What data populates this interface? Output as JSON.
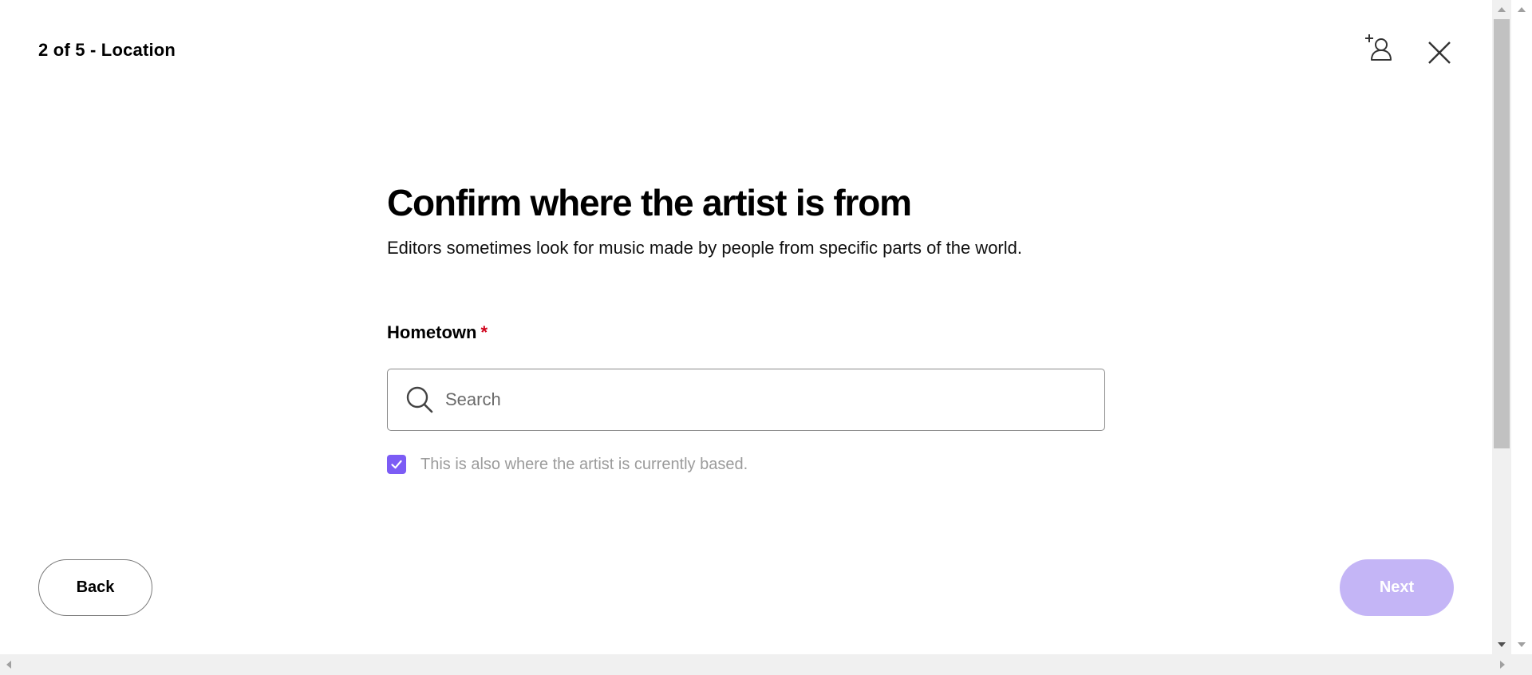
{
  "header": {
    "step_label": "2 of 5 - Location",
    "add_user_icon": "add-user-icon",
    "close_icon": "close-icon"
  },
  "main": {
    "title": "Confirm where the artist is from",
    "subtitle": "Editors sometimes look for music made by people from specific parts of the world.",
    "hometown": {
      "label": "Hometown",
      "required_marker": "*",
      "placeholder": "Search",
      "value": ""
    },
    "currently_based": {
      "checked": true,
      "label": "This is also where the artist is currently based."
    }
  },
  "footer": {
    "back_label": "Back",
    "next_label": "Next",
    "next_enabled": false
  },
  "colors": {
    "accent": "#7c5cf5",
    "next_disabled": "#c4b5f6",
    "required": "#d0021b"
  }
}
